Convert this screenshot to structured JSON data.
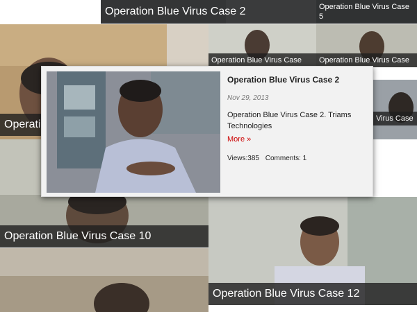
{
  "tiles": [
    {
      "caption": "Operation Blue Virus Case 2"
    },
    {
      "caption": "Operation Blue Virus Case 5"
    },
    {
      "caption": "Operation"
    },
    {
      "caption": "Operation Blue Virus Case"
    },
    {
      "caption": "Operation Blue Virus Case"
    },
    {
      "caption": "Virus Case"
    },
    {
      "caption": "Operation Blue Virus Case 10"
    },
    {
      "caption": "Operation Blue Virus Case 12"
    }
  ],
  "popup": {
    "title": "Operation Blue Virus Case 2",
    "date": "Nov 29, 2013",
    "description": "Operation Blue Virus Case 2. Triams Technologies",
    "more_label": "More »",
    "views": "Views:385",
    "comments": "Comments: 1"
  },
  "colors": {
    "more_link": "#cc0000",
    "caption_bg": "#1e1e1e"
  }
}
